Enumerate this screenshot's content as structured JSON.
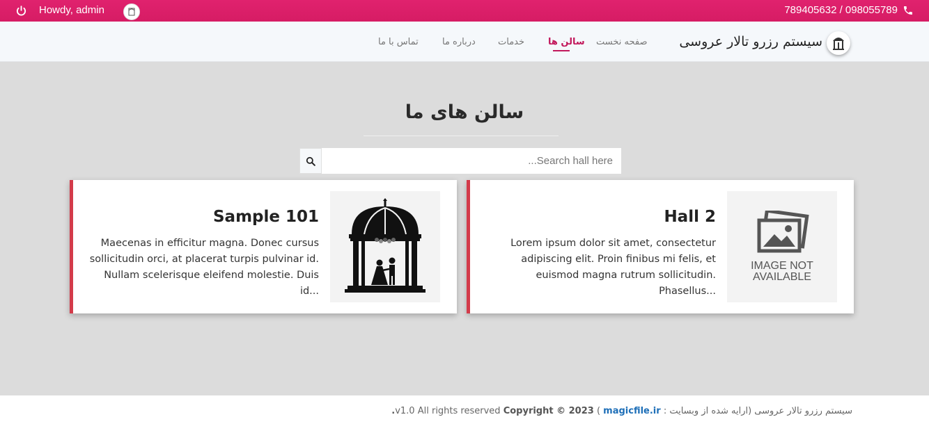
{
  "topbar": {
    "greeting": "Howdy, admin",
    "phones": "789405632 / 098055789"
  },
  "nav": {
    "brand": "سیستم رزرو تالار عروسی",
    "items": [
      {
        "label": "صفحه نخست",
        "active": false
      },
      {
        "label": "سالن ها",
        "active": true
      },
      {
        "label": "خدمات",
        "active": false
      },
      {
        "label": "درباره ما",
        "active": false
      },
      {
        "label": "تماس با ما",
        "active": false
      }
    ]
  },
  "main": {
    "title": "سالن های ما",
    "search": {
      "placeholder": "Search hall here..."
    },
    "cards": [
      {
        "title": "Sample 101",
        "lines": [
          "Maecenas in efficitur magna. Donec cursus",
          "sollicitudin orci, at placerat turpis pulvinar id.",
          "Nullam scelerisque eleifend molestie. Duis id..."
        ],
        "image": "gazebo-wedding-image"
      },
      {
        "title": "Hall 2",
        "lines": [
          "Lorem ipsum dolor sit amet, consectetur",
          "adipiscing elit. Proin finibus mi felis, et",
          "euismod magna rutrum sollicitudin. Phasellus..."
        ],
        "image": "image-not-available",
        "placeholder_text_1": "IMAGE NOT",
        "placeholder_text_2": "AVAILABLE"
      }
    ]
  },
  "footer": {
    "brand": "سیستم رزرو تالار عروسی (ارایه شده از وبسایت :",
    "site": "magicfile.ir",
    "rest": " ) v1.0",
    "copyright": "Copyright © 2023.",
    "rights": " All rights reserved"
  },
  "colors": {
    "accent": "#e0226e",
    "card_border": "#d33b4a",
    "link": "#1e6fb8"
  }
}
